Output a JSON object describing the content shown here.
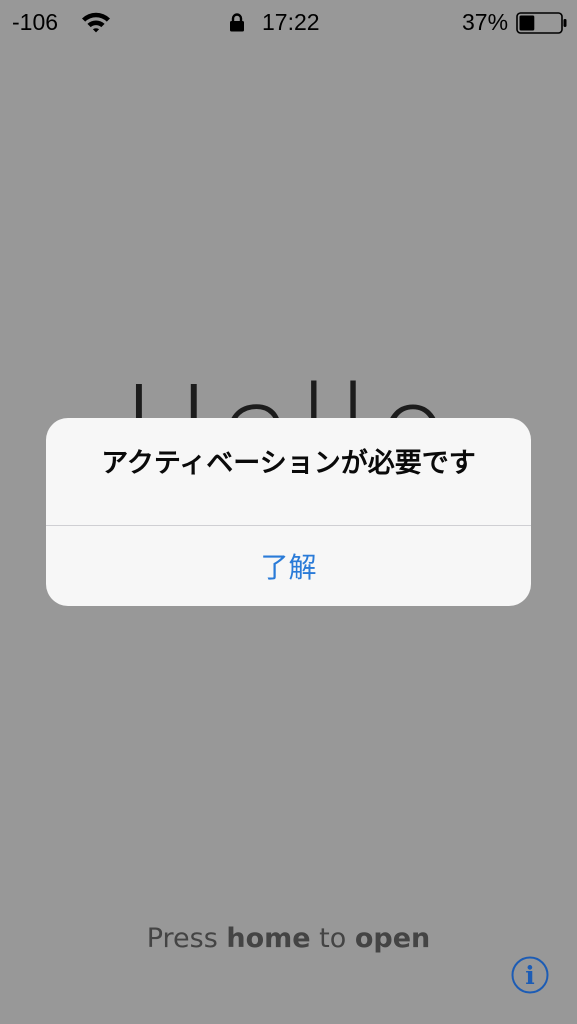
{
  "status_bar": {
    "signal": "-106",
    "wifi_icon": "wifi-icon",
    "lock_icon": "lock-icon",
    "time": "17:22",
    "battery_percent": "37%",
    "battery_level": 0.37,
    "battery_icon": "battery-icon"
  },
  "background": {
    "greeting": "Hello"
  },
  "alert": {
    "title": "アクティベーションが必要です",
    "button_label": "了解"
  },
  "bottom": {
    "prompt_part1": "Press ",
    "prompt_part2": "home",
    "prompt_part3": " to ",
    "prompt_part4": "open",
    "info_icon": "info-icon"
  },
  "colors": {
    "background": "#989898",
    "alert_background": "#f7f7f7",
    "button_text": "#2a7bd8",
    "info_icon": "#1c5cb5"
  }
}
